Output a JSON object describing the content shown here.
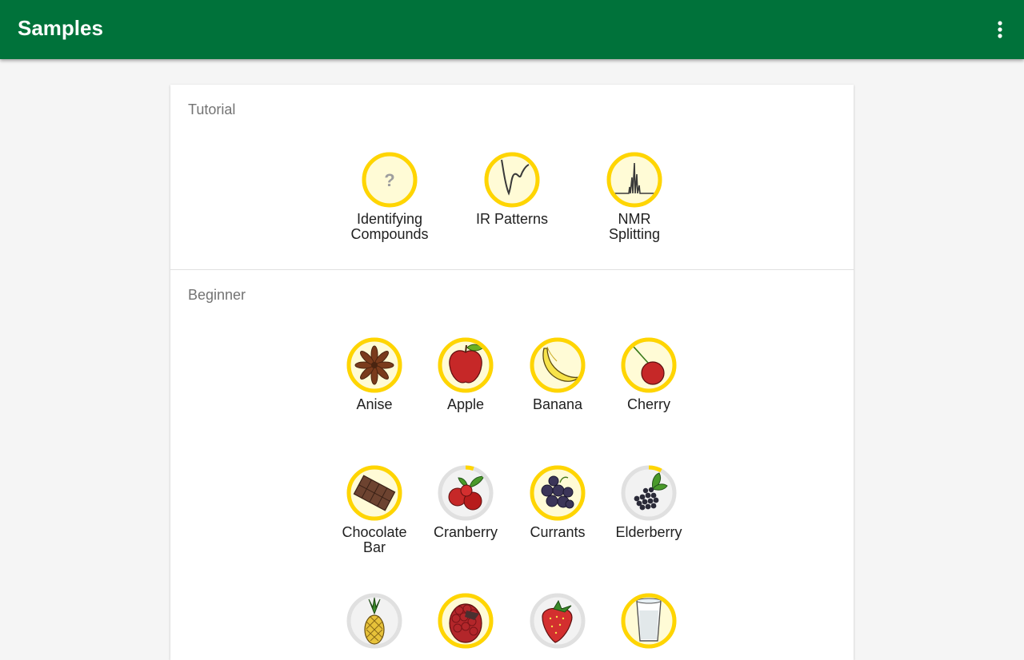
{
  "app": {
    "title": "Samples",
    "menu_icon": "more-vert-icon"
  },
  "colors": {
    "app_bar": "#00723a",
    "badge_complete": "#ffd500",
    "badge_incomplete": "#e0e0e0",
    "badge_fill": "#fffbd6"
  },
  "sections": [
    {
      "title": "Tutorial",
      "items": [
        {
          "label": "Identifying\nCompounds",
          "icon": "question-mark-icon",
          "progress": 1.0
        },
        {
          "label": "IR Patterns",
          "icon": "ir-spectrum-icon",
          "progress": 1.0
        },
        {
          "label": "NMR\nSplitting",
          "icon": "nmr-peaks-icon",
          "progress": 1.0
        }
      ]
    },
    {
      "title": "Beginner",
      "items": [
        {
          "label": "Anise",
          "icon": "star-anise-icon",
          "progress": 1.0
        },
        {
          "label": "Apple",
          "icon": "apple-icon",
          "progress": 1.0
        },
        {
          "label": "Banana",
          "icon": "banana-icon",
          "progress": 1.0
        },
        {
          "label": "Cherry",
          "icon": "cherry-icon",
          "progress": 1.0
        },
        {
          "label": "Chocolate\nBar",
          "icon": "chocolate-bar-icon",
          "progress": 1.0
        },
        {
          "label": "Cranberry",
          "icon": "cranberry-icon",
          "progress": 0.05
        },
        {
          "label": "Currants",
          "icon": "currants-icon",
          "progress": 1.0
        },
        {
          "label": "Elderberry",
          "icon": "elderberry-icon",
          "progress": 0.08
        },
        {
          "label": "",
          "icon": "pineapple-icon",
          "progress": 0.0
        },
        {
          "label": "",
          "icon": "raspberry-icon",
          "progress": 1.0
        },
        {
          "label": "",
          "icon": "strawberry-icon",
          "progress": 0.0
        },
        {
          "label": "",
          "icon": "milk-glass-icon",
          "progress": 1.0
        }
      ]
    }
  ]
}
